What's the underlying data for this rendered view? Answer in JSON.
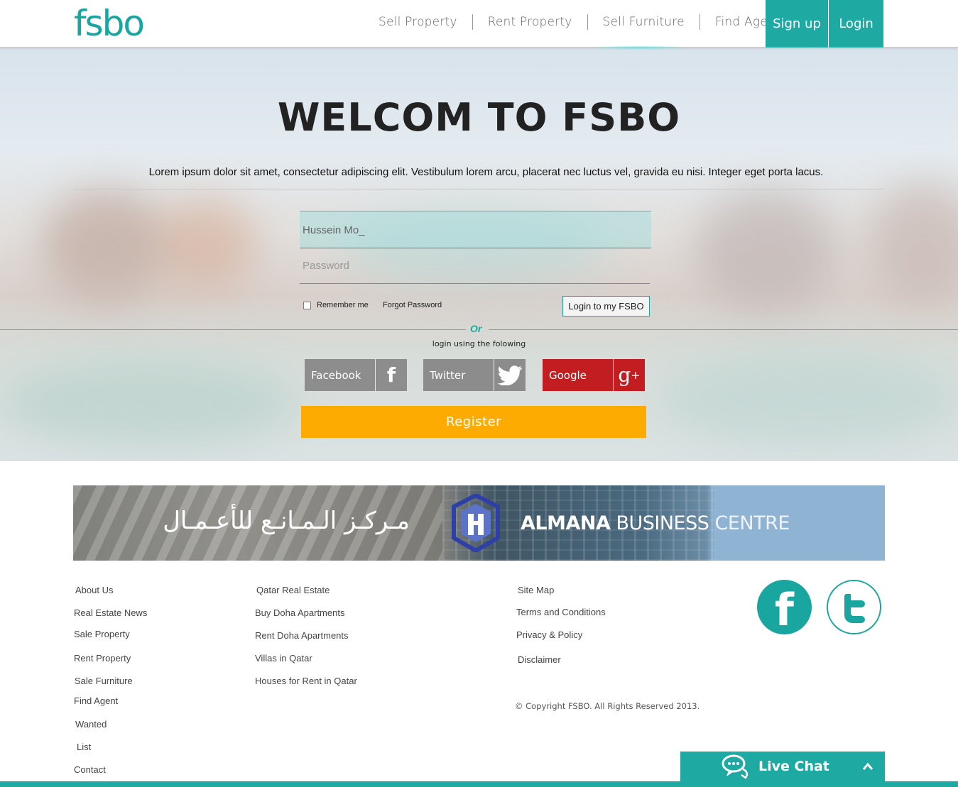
{
  "header": {
    "logo": "fsbo",
    "nav": [
      "Sell Property",
      "Rent Property",
      "Sell Furniture",
      "Find Agents"
    ],
    "signup_label": "Sign up",
    "login_label": "Login"
  },
  "hero": {
    "title": "WELCOM TO FSBO",
    "subtitle": "Lorem ipsum dolor sit amet, consectetur adipiscing elit. Vestibulum lorem arcu, placerat nec luctus vel, gravida eu nisi. Integer eget porta lacus.",
    "username_value": "Hussein Mo_",
    "password_placeholder": "Password",
    "remember_label": "Remember me",
    "forgot_label": "Forgot Password",
    "login_button": "Login to my FSBO",
    "or_label": "Or",
    "or_sub": "login using the folowing",
    "social": {
      "facebook": "Facebook",
      "twitter": "Twitter",
      "google": "Google"
    },
    "register_label": "Register"
  },
  "banner": {
    "arabic": "مـركـز الـمـانـع للأعـمـال",
    "brand_bold": "ALMANA",
    "brand_mid": "BUSINESS",
    "brand_light": "CENTRE"
  },
  "footer": {
    "col1": [
      "About Us",
      "Real Estate News",
      "Sale Property",
      "Rent Property",
      "Sale Furniture",
      "Find Agent",
      "Wanted",
      "List",
      "Contact"
    ],
    "col2": [
      "Qatar Real Estate",
      "Buy Doha Apartments",
      "Rent Doha Apartments",
      "Villas in Qatar",
      "Houses for Rent in Qatar"
    ],
    "col3": [
      "Site Map",
      "Terms and Conditions",
      "Privacy & Policy",
      "Disclaimer"
    ],
    "copyright": "© Copyright FSBO. All Rights Reserved 2013.",
    "livechat_label": "Live Chat"
  },
  "colors": {
    "brand_teal": "#1ea9a2",
    "register_orange": "#fdab00",
    "google_red": "#c21e22",
    "social_gray": "#8d8d8d"
  }
}
